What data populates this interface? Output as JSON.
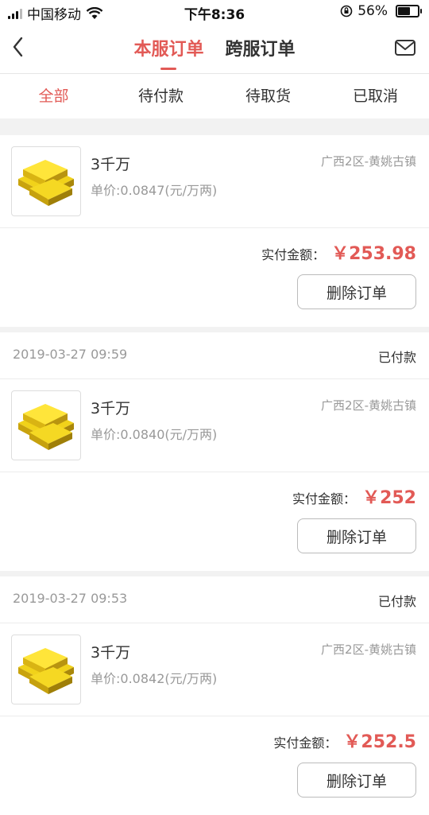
{
  "statusbar": {
    "carrier": "中国移动",
    "time": "下午8:36",
    "battery": "56%",
    "battery_level": 0.56
  },
  "header": {
    "tabs": [
      {
        "label": "本服订单",
        "active": true
      },
      {
        "label": "跨服订单",
        "active": false
      }
    ]
  },
  "filters": [
    {
      "label": "全部",
      "active": true
    },
    {
      "label": "待付款",
      "active": false
    },
    {
      "label": "待取货",
      "active": false
    },
    {
      "label": "已取消",
      "active": false
    }
  ],
  "orders": [
    {
      "date": "",
      "status": "",
      "title": "3千万",
      "unit_price": "单价:0.0847(元/万两)",
      "server": "广西2区-黄姚古镇",
      "total_label": "实付金额：",
      "total": "￥253.98",
      "delete_label": "删除订单"
    },
    {
      "date": "2019-03-27 09:59",
      "status": "已付款",
      "title": "3千万",
      "unit_price": "单价:0.0840(元/万两)",
      "server": "广西2区-黄姚古镇",
      "total_label": "实付金额：",
      "total": "￥252",
      "delete_label": "删除订单"
    },
    {
      "date": "2019-03-27 09:53",
      "status": "已付款",
      "title": "3千万",
      "unit_price": "单价:0.0842(元/万两)",
      "server": "广西2区-黄姚古镇",
      "total_label": "实付金额：",
      "total": "￥252.5",
      "delete_label": "删除订单"
    }
  ]
}
